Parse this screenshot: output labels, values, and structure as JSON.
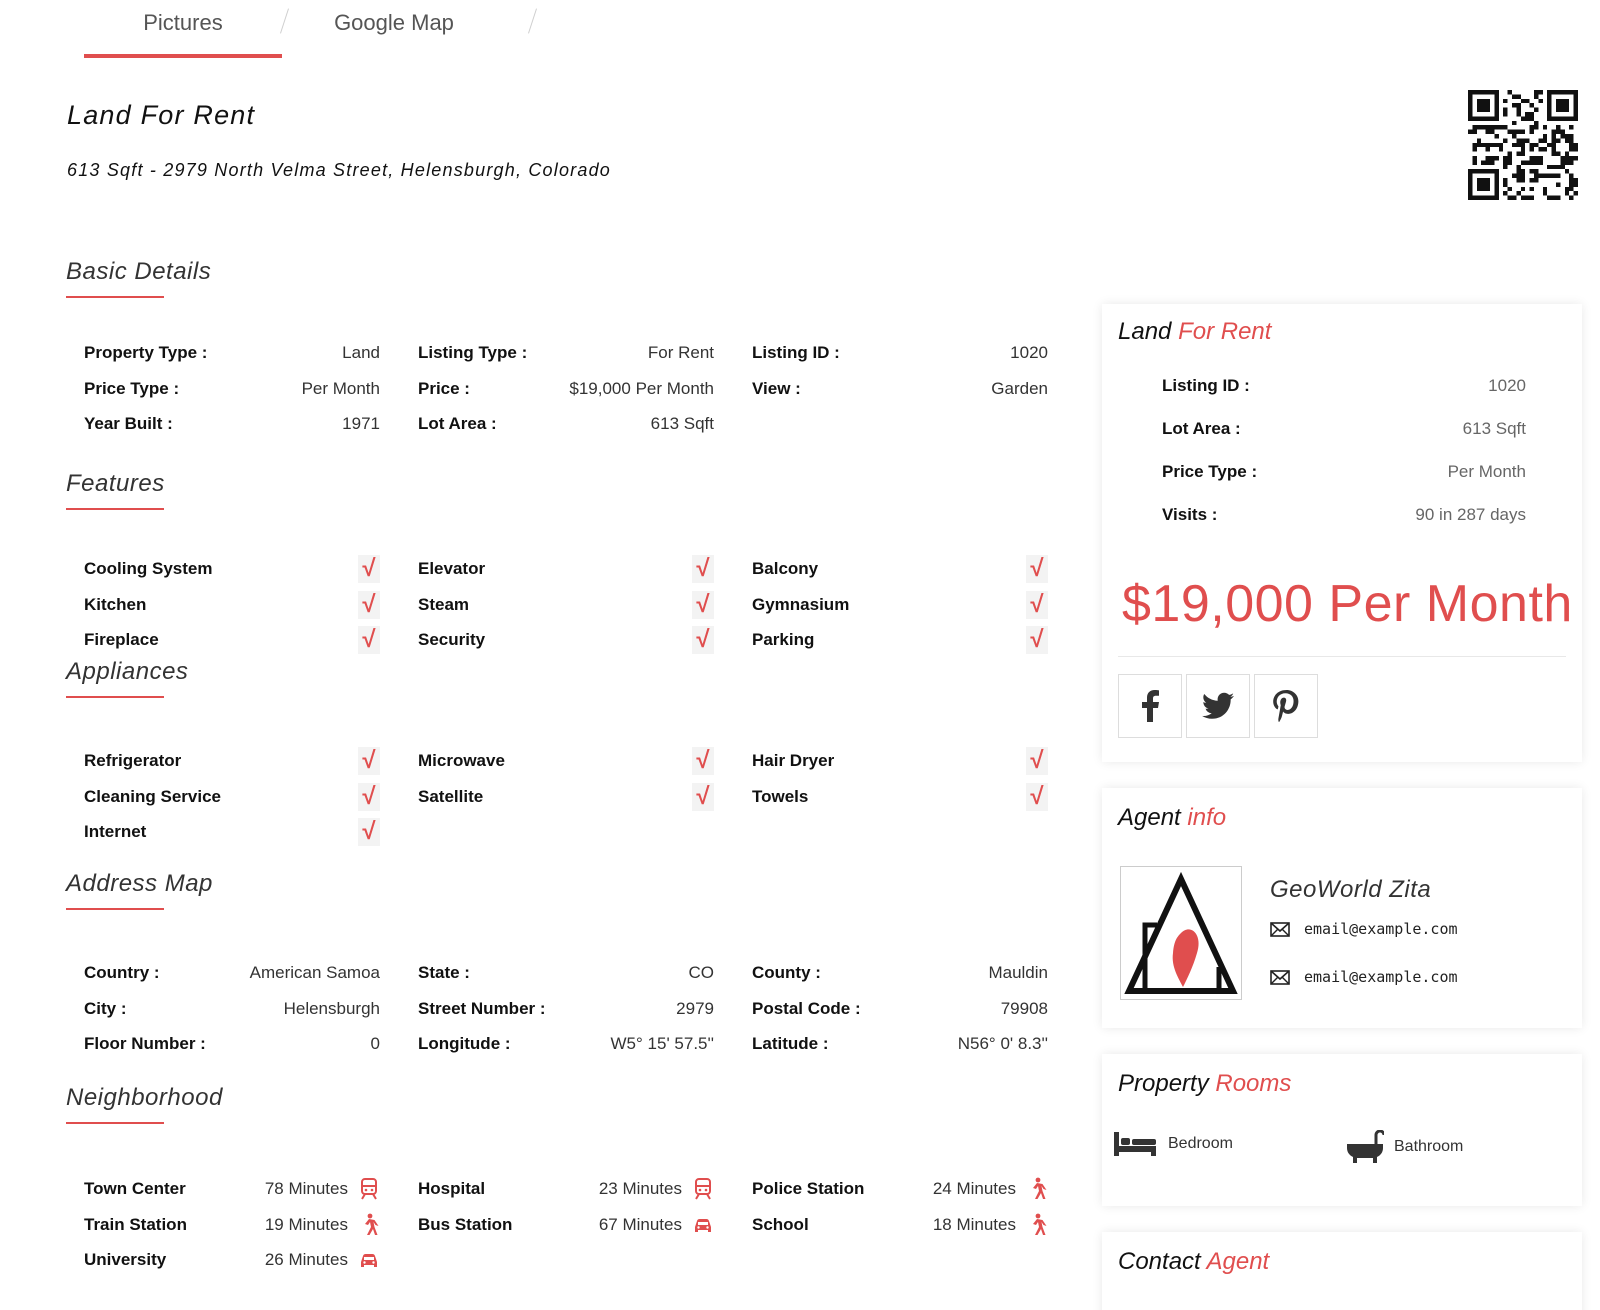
{
  "tabs": {
    "pictures": "Pictures",
    "google_map": "Google Map"
  },
  "title": "Land For Rent",
  "subtitle": "613 Sqft - 2979 North Velma Street, Helensburgh, Colorado",
  "sections": {
    "basic": "Basic Details",
    "features": "Features",
    "appliances": "Appliances",
    "address": "Address Map",
    "neighborhood": "Neighborhood"
  },
  "basic_details": [
    {
      "label": "Property Type :",
      "value": "Land"
    },
    {
      "label": "Listing Type :",
      "value": "For Rent"
    },
    {
      "label": "Listing ID :",
      "value": "1020"
    },
    {
      "label": "Price Type :",
      "value": "Per Month"
    },
    {
      "label": "Price :",
      "value": "$19,000 Per Month"
    },
    {
      "label": "View :",
      "value": "Garden"
    },
    {
      "label": "Year Built :",
      "value": "1971"
    },
    {
      "label": "Lot Area :",
      "value": "613 Sqft"
    }
  ],
  "features": [
    "Cooling System",
    "Elevator",
    "Balcony",
    "Kitchen",
    "Steam",
    "Gymnasium",
    "Fireplace",
    "Security",
    "Parking"
  ],
  "appliances": [
    "Refrigerator",
    "Microwave",
    "Hair Dryer",
    "Cleaning Service",
    "Satellite",
    "Towels",
    "Internet"
  ],
  "check_mark": "√",
  "address": [
    {
      "label": "Country :",
      "value": "American Samoa"
    },
    {
      "label": "State :",
      "value": "CO"
    },
    {
      "label": "County :",
      "value": "Mauldin"
    },
    {
      "label": "City :",
      "value": "Helensburgh"
    },
    {
      "label": "Street Number :",
      "value": "2979"
    },
    {
      "label": "Postal Code :",
      "value": "79908"
    },
    {
      "label": "Floor Number :",
      "value": "0"
    },
    {
      "label": "Longitude :",
      "value": "W5° 15' 57.5''"
    },
    {
      "label": "Latitude :",
      "value": "N56° 0' 8.3''"
    }
  ],
  "neighborhood": [
    {
      "label": "Town Center",
      "value": "78 Minutes",
      "icon": "train-icon"
    },
    {
      "label": "Hospital",
      "value": "23 Minutes",
      "icon": "train-icon"
    },
    {
      "label": "Police Station",
      "value": "24 Minutes",
      "icon": "walk-icon"
    },
    {
      "label": "Train Station",
      "value": "19 Minutes",
      "icon": "walk-icon"
    },
    {
      "label": "Bus Station",
      "value": "67 Minutes",
      "icon": "car-icon"
    },
    {
      "label": "School",
      "value": "18 Minutes",
      "icon": "walk-icon"
    },
    {
      "label": "University",
      "value": "26 Minutes",
      "icon": "car-icon"
    }
  ],
  "sidebar": {
    "summary": {
      "title_main": "Land ",
      "title_accent": "For Rent",
      "rows": [
        {
          "label": "Listing ID :",
          "value": "1020"
        },
        {
          "label": "Lot Area :",
          "value": "613 Sqft"
        },
        {
          "label": "Price Type :",
          "value": "Per Month"
        },
        {
          "label": "Visits :",
          "value": "90 in 287 days"
        }
      ],
      "price": "$19,000 Per Month",
      "social": [
        "facebook-icon",
        "twitter-icon",
        "pinterest-icon"
      ]
    },
    "agent": {
      "title_main": "Agent ",
      "title_accent": "info",
      "name": "GeoWorld Zita",
      "emails": [
        "email@example.com",
        "email@example.com"
      ]
    },
    "rooms": {
      "title_main": "Property ",
      "title_accent": "Rooms",
      "items": [
        {
          "label": "Bedroom",
          "icon": "bed-icon"
        },
        {
          "label": "Bathroom",
          "icon": "bathtub-icon"
        }
      ]
    },
    "contact": {
      "title_main": "Contact ",
      "title_accent": "Agent"
    }
  },
  "colors": {
    "accent": "#e04e4e",
    "text": "#111111",
    "muted": "#666666"
  }
}
